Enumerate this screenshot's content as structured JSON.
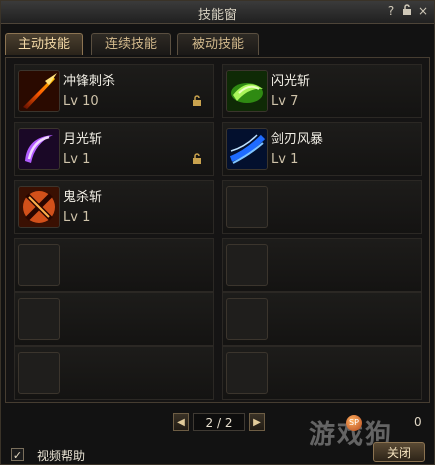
{
  "window": {
    "title": "技能窗"
  },
  "titlebar": {
    "help_icon": "?",
    "lock_icon": "lock-icon",
    "close_icon": "×"
  },
  "tabs": [
    {
      "label": "主动技能",
      "active": true
    },
    {
      "label": "连续技能",
      "active": false
    },
    {
      "label": "被动技能",
      "active": false
    }
  ],
  "skills": [
    {
      "name": "冲锋刺杀",
      "level": "Lv 10",
      "icon": "charge-stab-icon",
      "locked": true
    },
    {
      "name": "闪光斩",
      "level": "Lv 7",
      "icon": "flash-slash-icon",
      "locked": false
    },
    {
      "name": "月光斩",
      "level": "Lv 1",
      "icon": "moonlight-slash-icon",
      "locked": true
    },
    {
      "name": "剑刃风暴",
      "level": "Lv 1",
      "icon": "blade-storm-icon",
      "locked": false
    },
    {
      "name": "鬼杀斩",
      "level": "Lv 1",
      "icon": "demon-slay-icon",
      "locked": false
    }
  ],
  "pager": {
    "text": "2 / 2",
    "prev": "◀",
    "next": "▶"
  },
  "skill_points": {
    "badge": "SP",
    "value": "0"
  },
  "help": {
    "checked": true,
    "check_mark": "✓",
    "label": "视频帮助"
  },
  "close_button": {
    "label": "关闭"
  },
  "watermark": {
    "text": "游戏狗"
  }
}
